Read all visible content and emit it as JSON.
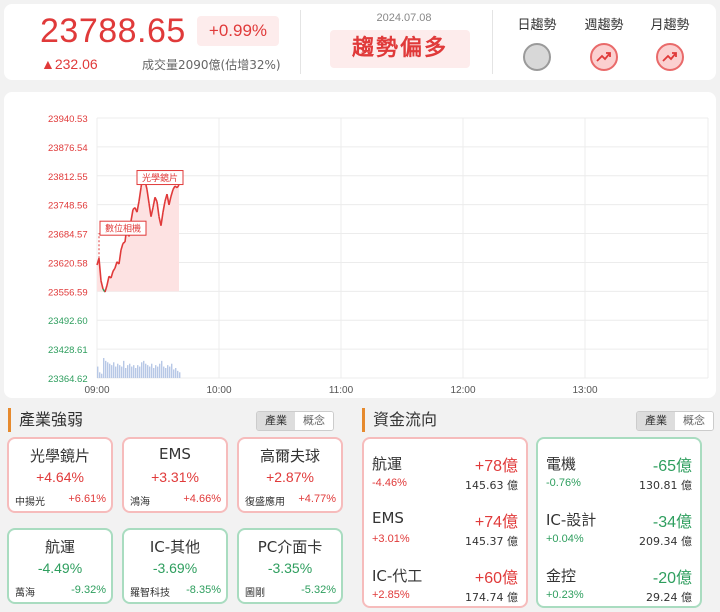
{
  "header": {
    "index_value": "23788.65",
    "index_pct": "+0.99%",
    "index_change": "▲232.06",
    "volume": "成交量2090億(估增32%)",
    "date": "2024.07.08",
    "trend_label": "趨勢偏多",
    "trends": [
      {
        "label": "日趨勢",
        "icon": "neutral-circle-icon",
        "state": "neutral"
      },
      {
        "label": "週趨勢",
        "icon": "trend-up-icon",
        "state": "up"
      },
      {
        "label": "月趨勢",
        "icon": "trend-up-icon",
        "state": "up"
      }
    ]
  },
  "colors": {
    "up": "#e03a3a",
    "down": "#2e9e5e",
    "up_fill": "#fde2e2",
    "accent": "#e68a2e",
    "volume": "#b7c8e6"
  },
  "chart_data": {
    "type": "line",
    "y_ticks": [
      "23940.53",
      "23876.54",
      "23812.55",
      "23748.56",
      "23684.57",
      "23620.58",
      "23556.59",
      "23492.60",
      "23428.61",
      "23364.62"
    ],
    "ylim": [
      23364.62,
      23940.53
    ],
    "reference": 23556.59,
    "x_ticks": [
      "09:00",
      "10:00",
      "11:00",
      "12:00",
      "13:00"
    ],
    "annotations": [
      {
        "text": "數位相機",
        "x": 1
      },
      {
        "text": "光學鏡片",
        "x": 24
      }
    ],
    "x": [
      0,
      1,
      2,
      3,
      4,
      5,
      6,
      7,
      8,
      9,
      10,
      11,
      12,
      13,
      14,
      15,
      16,
      17,
      18,
      19,
      20,
      21,
      22,
      23,
      24,
      25,
      26,
      27,
      28,
      29,
      30,
      31,
      32,
      33,
      34,
      35,
      36,
      37,
      38,
      39,
      40,
      41
    ],
    "y": [
      23615,
      23630,
      23580,
      23562,
      23555,
      23570,
      23590,
      23586,
      23601,
      23608,
      23622,
      23617,
      23648,
      23663,
      23666,
      23702,
      23678,
      23712,
      23738,
      23742,
      23732,
      23756,
      23786,
      23818,
      23802,
      23782,
      23752,
      23722,
      23742,
      23765,
      23755,
      23722,
      23702,
      23732,
      23756,
      23772,
      23748,
      23767,
      23782,
      23790,
      23786,
      23792
    ],
    "volume": [
      8,
      4,
      3,
      14,
      12,
      11,
      10,
      9,
      11,
      8,
      10,
      9,
      8,
      12,
      7,
      9,
      10,
      8,
      9,
      7,
      9,
      8,
      11,
      12,
      10,
      9,
      8,
      10,
      7,
      9,
      8,
      10,
      12,
      8,
      7,
      9,
      8,
      10,
      6,
      7,
      5,
      4
    ]
  },
  "industry": {
    "title": "產業強弱",
    "toggle": [
      "產業",
      "概念"
    ],
    "cards": [
      {
        "name": "光學鏡片",
        "pct": "+4.64%",
        "stock": "中揚光",
        "stock_pct": "+6.61%",
        "dir": "up"
      },
      {
        "name": "EMS",
        "pct": "+3.31%",
        "stock": "鴻海",
        "stock_pct": "+4.66%",
        "dir": "up"
      },
      {
        "name": "高爾夫球",
        "pct": "+2.87%",
        "stock": "復盛應用",
        "stock_pct": "+4.77%",
        "dir": "up"
      },
      {
        "name": "航運",
        "pct": "-4.49%",
        "stock": "萬海",
        "stock_pct": "-9.32%",
        "dir": "down"
      },
      {
        "name": "IC-其他",
        "pct": "-3.69%",
        "stock": "羅智科技",
        "stock_pct": "-8.35%",
        "dir": "down"
      },
      {
        "name": "PC介面卡",
        "pct": "-3.35%",
        "stock": "圖剛",
        "stock_pct": "-5.32%",
        "dir": "down"
      }
    ]
  },
  "fund_flow": {
    "title": "資金流向",
    "toggle": [
      "產業",
      "概念"
    ],
    "inflow": [
      {
        "name": "航運",
        "amount": "+78億",
        "pct": "-4.46%",
        "volume": "145.63 億"
      },
      {
        "name": "EMS",
        "amount": "+74億",
        "pct": "+3.01%",
        "volume": "145.37 億"
      },
      {
        "name": "IC-代工",
        "amount": "+60億",
        "pct": "+2.85%",
        "volume": "174.74 億"
      }
    ],
    "outflow": [
      {
        "name": "電機",
        "amount": "-65億",
        "pct": "-0.76%",
        "volume": "130.81 億"
      },
      {
        "name": "IC-設計",
        "amount": "-34億",
        "pct": "+0.04%",
        "volume": "209.34 億"
      },
      {
        "name": "金控",
        "amount": "-20億",
        "pct": "+0.23%",
        "volume": "29.24 億"
      }
    ]
  }
}
